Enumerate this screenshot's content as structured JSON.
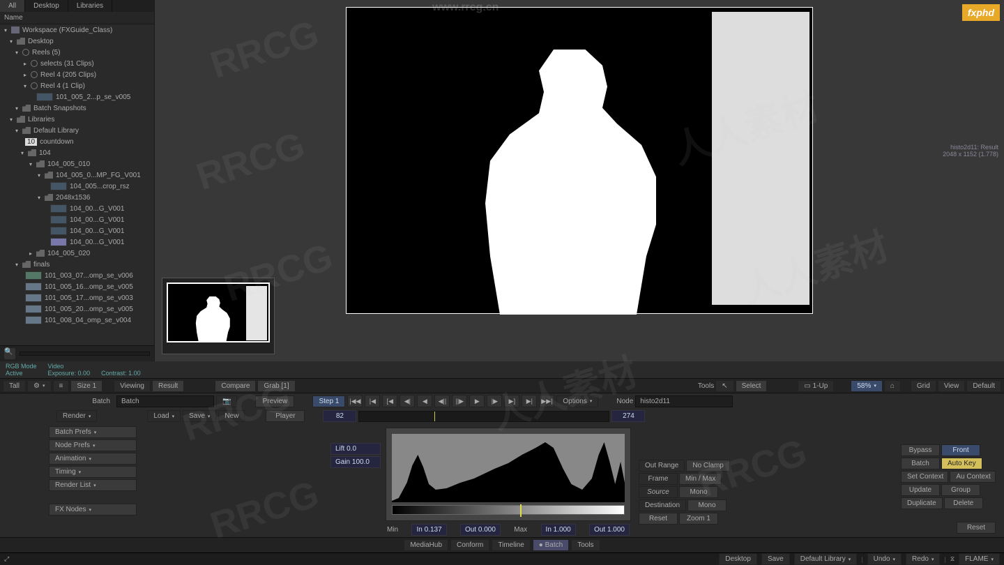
{
  "tabs": {
    "all": "All",
    "desktop": "Desktop",
    "libraries": "Libraries"
  },
  "nameHeader": "Name",
  "workspace": "Workspace (FXGuide_Class)",
  "tree": {
    "desktop": "Desktop",
    "reels": "Reels (5)",
    "selects": "selects (31 Clips)",
    "reel4_205": "Reel 4 (205 Clips)",
    "reel4_1": "Reel 4 (1 Clip)",
    "clip1": "101_005_2...p_se_v005",
    "batchSnap": "Batch Snapshots",
    "libraries": "Libraries",
    "defLib": "Default Library",
    "countdownNum": "10",
    "countdown": "countdown",
    "f104": "104",
    "f104_005_010": "104_005_010",
    "f104_005_0": "104_005_0...MP_FG_V001",
    "f104_005_crop": "104_005...crop_rsz",
    "res": "2048x1536",
    "g1": "104_00...G_V001",
    "g2": "104_00...G_V001",
    "g3": "104_00...G_V001",
    "g4": "104_00...G_V001",
    "f104_005_020": "104_005_020",
    "finals": "finals",
    "fin1": "101_003_07...omp_se_v006",
    "fin2": "101_005_16...omp_se_v005",
    "fin3": "101_005_17...omp_se_v003",
    "fin4": "101_005_20...omp_se_v005",
    "fin5": "101_008_04_omp_se_v004"
  },
  "leftBar": {
    "tall": "Tall",
    "size": "Size 1"
  },
  "info": {
    "rgbMode": "RGB Mode",
    "active": "Active",
    "video": "Video",
    "exposure": "Exposure: 0.00",
    "contrast": "Contrast: 1.00"
  },
  "viewBar": {
    "viewing": "Viewing",
    "result": "Result",
    "compare": "Compare",
    "grab": "Grab [1]",
    "tools": "Tools",
    "select": "Select",
    "oneup": "1-Up",
    "zoom": "58%",
    "grid": "Grid",
    "view": "View",
    "default": "Default"
  },
  "rightInfo": {
    "node": "histo2d11: Result",
    "dims": "2048 x 1152 (1.778)"
  },
  "batchRow": {
    "batchLbl": "Batch",
    "batch": "Batch",
    "preview": "Preview",
    "step": "Step 1",
    "options": "Options",
    "nodeLbl": "Node",
    "node": "histo2d11"
  },
  "playerRow": {
    "render": "Render",
    "load": "Load",
    "save": "Save",
    "new": "New",
    "player": "Player",
    "cur": "82",
    "end": "274"
  },
  "leftBtns": {
    "batchPrefs": "Batch Prefs",
    "nodePrefs": "Node Prefs",
    "animation": "Animation",
    "timing": "Timing",
    "renderList": "Render List",
    "fxNodes": "FX Nodes"
  },
  "histo": {
    "lift": "Lift 0.0",
    "gain": "Gain 100.0",
    "min": "Min",
    "inVal": "In 0.137",
    "outLow": "Out 0.000",
    "max": "Max",
    "inHigh": "In 1.000",
    "outHigh": "Out 1.000"
  },
  "params": {
    "outRange": "Out Range",
    "noClamp": "No Clamp",
    "frame": "Frame",
    "minmax": "Min / Max",
    "source": "Source",
    "mono": "Mono",
    "destination": "Destination",
    "mono2": "Mono",
    "reset": "Reset",
    "zoom1": "Zoom 1"
  },
  "rightBtns": {
    "bypass": "Bypass",
    "front": "Front",
    "batch": "Batch",
    "autoKey": "Auto Key",
    "setContext": "Set Context",
    "auContext": "Au Context",
    "update": "Update",
    "group": "Group",
    "duplicate": "Duplicate",
    "delete": "Delete",
    "reset": "Reset"
  },
  "bottomTabs": {
    "mediaHub": "MediaHub",
    "conform": "Conform",
    "timeline": "Timeline",
    "batch": "Batch",
    "tools": "Tools"
  },
  "bottomBar": {
    "desktop": "Desktop",
    "save": "Save",
    "defLib": "Default Library",
    "undo": "Undo",
    "redo": "Redo",
    "flame": "FLAME"
  },
  "brand": "fxphd",
  "urlwm": "www.rrcg.cn"
}
